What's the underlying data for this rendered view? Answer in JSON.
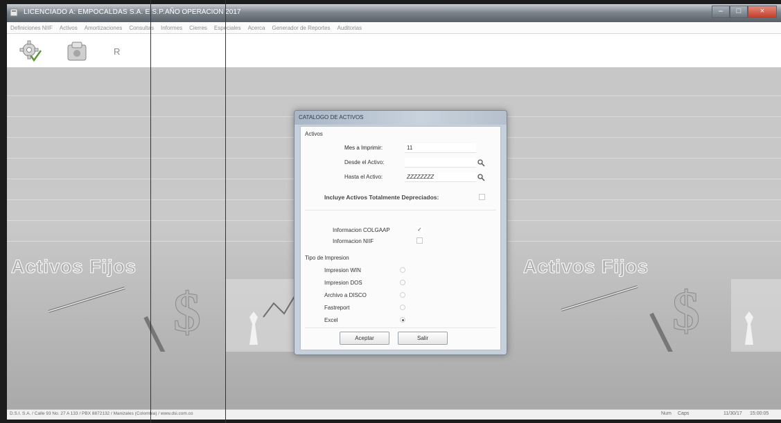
{
  "window": {
    "title": "LICENCIADO A: EMPOCALDAS S.A. E.S.P.",
    "year": "AÑO OPERACION 2017",
    "buttons": {
      "minimize": "–",
      "maximize": "□",
      "close": "×"
    }
  },
  "menu": [
    "Definiciones NIIF",
    "Activos",
    "Amortizaciones",
    "Consultas",
    "Informes",
    "Cierres",
    "Especiales",
    "Acerca",
    "Generador de Reportes",
    "Auditorias"
  ],
  "toolbar": [
    {
      "icon": "gear-icon"
    },
    {
      "icon": "exit-icon"
    },
    {
      "icon": "help-icon"
    }
  ],
  "background": {
    "title_left": "Activos Fijos",
    "title_right": "Activos Fijos"
  },
  "dialog": {
    "title": "CATALOGO DE ACTIVOS",
    "section_activos": "Activos",
    "mes_label": "Mes a Imprimir:",
    "mes_value": "11",
    "desde_label": "Desde el Activo:",
    "desde_value": "",
    "hasta_label": "Hasta el Activo:",
    "hasta_value": "ZZZZZZZZ",
    "incluye_label": "Incluye Activos Totalmente Depreciados:",
    "incluye_checked": false,
    "info_colgaap_label": "Informacion COLGAAP",
    "info_colgaap_checked": true,
    "info_niif_label": "Informacion NIIF",
    "info_niif_checked": false,
    "tipo_impresion_label": "Tipo de Impresion",
    "print_options": [
      {
        "label": "Impresion WIN",
        "selected": false
      },
      {
        "label": "Impresion DOS",
        "selected": false
      },
      {
        "label": "Archivo a DISCO",
        "selected": false
      },
      {
        "label": "Fastreport",
        "selected": false
      },
      {
        "label": "Excel",
        "selected": true
      }
    ],
    "accept_label": "Aceptar",
    "exit_label": "Salir"
  },
  "statusbar": {
    "text": "D.S.I. S.A. / Calle 93 No. 27 A 133 / PBX 8872132 / Manizales (Colombia) / www.dsi.com.co",
    "num": "Num",
    "caps": "Caps",
    "date": "11/30/17",
    "time": "15:00:05"
  }
}
